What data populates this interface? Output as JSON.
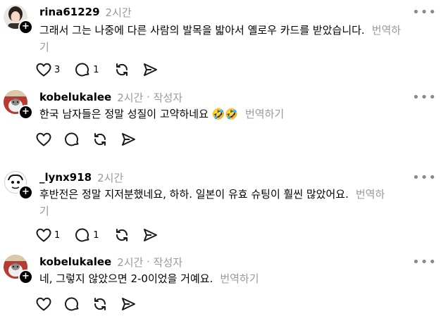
{
  "posts": [
    {
      "username": "rina61229",
      "time": "2시간",
      "author_tag": "",
      "text": "그래서 그는 나중에 다른 사람의 발목을 밟아서 옐로우 카드를 받았습니다.",
      "translate": "번역하기",
      "likes": "3",
      "replies": "1",
      "avatar": "person-photo"
    },
    {
      "username": "kobelukalee",
      "time": "2시간",
      "author_tag": "작성자",
      "text": "한국 남자들은 정말 성질이 고약하네요 🤣🤣",
      "translate": "번역하기",
      "likes": "",
      "replies": "",
      "avatar": "cat-photo"
    },
    {
      "username": "_lynx918",
      "time": "2시간",
      "author_tag": "",
      "text": "후반전은 정말 지저분했네요, 하하. 일본이 유효 슈팅이 훨씬 많았어요.",
      "translate": "번역하기",
      "likes": "1",
      "replies": "1",
      "avatar": "drawn-face"
    },
    {
      "username": "kobelukalee",
      "time": "2시간",
      "author_tag": "작성자",
      "text": "네, 그렇지 않았으면 2-0이었을 거예요.",
      "translate": "번역하기",
      "likes": "",
      "replies": "",
      "avatar": "cat-photo"
    }
  ],
  "icons": {
    "like": "heart-icon",
    "reply": "comment-icon",
    "repost": "repost-icon",
    "share": "send-icon",
    "more": "more-icon",
    "follow": "plus-icon"
  },
  "colors": {
    "text": "#000000",
    "muted": "#999999",
    "icon": "#1a1a1a"
  }
}
